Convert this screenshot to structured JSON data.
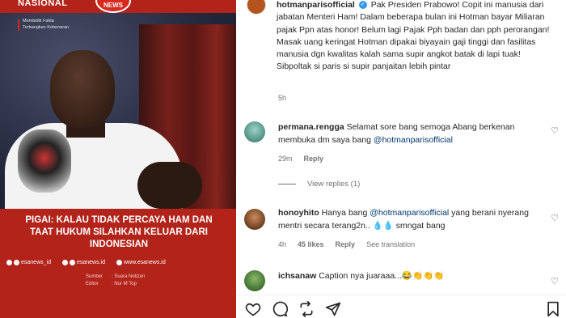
{
  "post_image": {
    "brand": "NASIONAL",
    "logo_text": "NEWS",
    "tagline_1": "Membidik Fakta",
    "tagline_2": "Terbangkan Kebenaran",
    "headline": "PIGAI: KALAU TIDAK PERCAYA HAM DAN TAAT HUKUM SILAHKAN KELUAR DARI INDONESIAN",
    "socials": [
      {
        "handle": "esanews_id"
      },
      {
        "handle": "esanews.id"
      },
      {
        "handle": "www.esanews.id"
      }
    ],
    "credits": [
      {
        "key": "Sumber",
        "value": ": Suara Netizen"
      },
      {
        "key": "Editor",
        "value": ": Nur M Top"
      }
    ],
    "colors": {
      "accent_red": "#b2231a"
    }
  },
  "caption": {
    "username": "hotmanparisofficial",
    "text": "Pak Presiden Prabowo! Copit ini manusia dari jabatan Menteri Ham! Dalam beberapa bulan ini Hotman bayar Miliaran pajak Ppn atas honor! Belum lagi Pajak Pph badan dan pph perorangan! Masak uang keringat Hotman dipakai biyayain gaji tinggi dan fasilitas manusia dgn kwalitas kalah sama supir angkot batak di lapi tuak! Sibpoltak si paris si supir panjaitan lebih pintar",
    "time": "5h"
  },
  "comments": [
    {
      "username": "permana.rengga",
      "text": "Selamat sore bang semoga Abang berkenan membuka dm saya bang",
      "mention": "@hotmanparisofficial",
      "time": "29m",
      "likes": "",
      "reply": "Reply",
      "translate": "",
      "view_replies": "View replies (1)"
    },
    {
      "username": "honoyhito",
      "text_before": "Hanya bang",
      "mention": "@hotmanparisofficial",
      "text_after": "yang berani nyerang mentri secara terang2n.. 💧💧 smngat bang",
      "time": "4h",
      "likes": "45 likes",
      "reply": "Reply",
      "translate": "See translation"
    },
    {
      "username": "ichsanaw",
      "text": "Caption nya juaraaa...😂👏👏👏",
      "time": ""
    }
  ],
  "actions": [
    "heart-icon",
    "comment-icon",
    "share-icon",
    "send-icon",
    "bookmark-icon"
  ]
}
